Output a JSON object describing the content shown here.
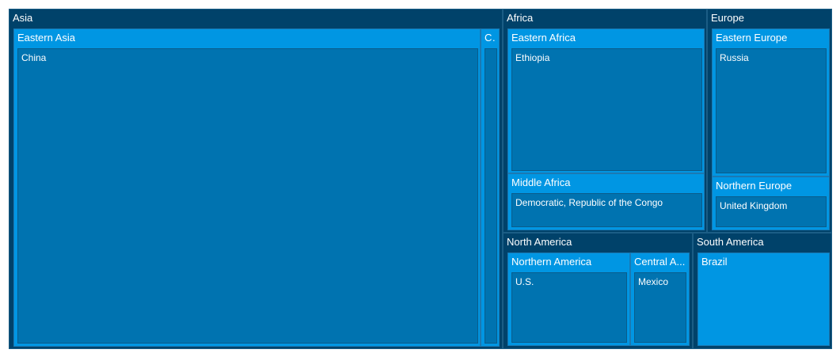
{
  "chart_data": {
    "type": "treemap",
    "title": "",
    "groups": [
      {
        "name": "Asia",
        "subgroups": [
          {
            "name": "Eastern Asia",
            "children": [
              {
                "name": "China",
                "value": 1400
              }
            ]
          },
          {
            "name": "Central Asia",
            "display_name": "C...",
            "children": [
              {
                "name": "",
                "value": 40
              }
            ]
          }
        ]
      },
      {
        "name": "Africa",
        "subgroups": [
          {
            "name": "Eastern Africa",
            "children": [
              {
                "name": "Ethiopia",
                "value": 110
              }
            ]
          },
          {
            "name": "Middle Africa",
            "children": [
              {
                "name": "Democratic, Republic of the Congo",
                "value": 86
              }
            ]
          }
        ]
      },
      {
        "name": "Europe",
        "subgroups": [
          {
            "name": "Eastern Europe",
            "children": [
              {
                "name": "Russia",
                "value": 146
              }
            ]
          },
          {
            "name": "Northern Europe",
            "children": [
              {
                "name": "United Kingdom",
                "value": 67
              }
            ]
          }
        ]
      },
      {
        "name": "North America",
        "subgroups": [
          {
            "name": "Northern America",
            "children": [
              {
                "name": "U.S.",
                "value": 330
              }
            ]
          },
          {
            "name": "Central America",
            "display_name": "Central A...",
            "children": [
              {
                "name": "Mexico",
                "value": 128
              }
            ]
          }
        ]
      },
      {
        "name": "South America",
        "subgroups": [
          {
            "name": "Brazil",
            "children": []
          }
        ]
      }
    ]
  }
}
